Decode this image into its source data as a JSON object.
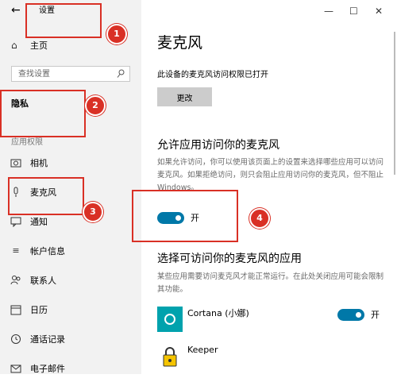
{
  "window": {
    "title": "设置",
    "back_glyph": "←",
    "minimize": "—",
    "maximize": "☐",
    "close": "✕"
  },
  "sidebar": {
    "home": "主页",
    "search_placeholder": "查找设置",
    "privacy": "隐私",
    "section": "应用权限",
    "items": [
      {
        "label": "相机",
        "icon": "camera-icon"
      },
      {
        "label": "麦克风",
        "icon": "microphone-icon"
      },
      {
        "label": "通知",
        "icon": "notification-icon"
      },
      {
        "label": "帐户信息",
        "icon": "account-info-icon"
      },
      {
        "label": "联系人",
        "icon": "contacts-icon"
      },
      {
        "label": "日历",
        "icon": "calendar-icon"
      },
      {
        "label": "通话记录",
        "icon": "call-history-icon"
      },
      {
        "label": "电子邮件",
        "icon": "email-icon"
      }
    ]
  },
  "main": {
    "title": "麦克风",
    "status": "此设备的麦克风访问权限已打开",
    "change_button": "更改",
    "allow_heading": "允许应用访问你的麦克风",
    "allow_desc": "如果允许访问，你可以使用该页面上的设置来选择哪些应用可以访问麦克风。如果拒绝访问，则只会阻止应用访问你的麦克风，但不阻止 Windows。",
    "allow_toggle_label": "开",
    "choose_heading": "选择可访问你的麦克风的应用",
    "choose_desc": "某些应用需要访问麦克风才能正常运行。在此处关闭应用可能会限制其功能。",
    "apps": [
      {
        "name": "Cortana (小娜)",
        "toggle_label": "开"
      },
      {
        "name": "Keeper"
      }
    ]
  },
  "annotations": [
    "1",
    "2",
    "3",
    "4"
  ],
  "colors": {
    "accent": "#0078a8",
    "annotation": "#d93025",
    "sidebar_bg": "#f2f2f2"
  }
}
